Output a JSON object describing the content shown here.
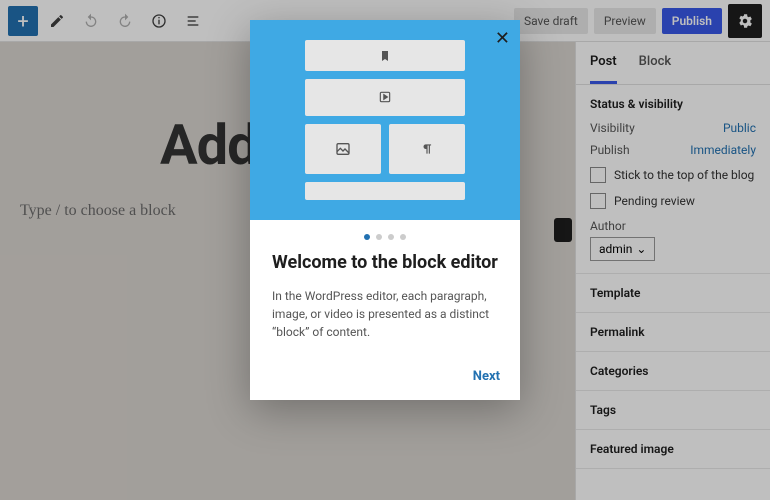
{
  "toolbar": {
    "save_draft": "Save draft",
    "preview": "Preview",
    "publish": "Publish"
  },
  "canvas": {
    "title_placeholder": "Add",
    "block_prompt": "Type / to choose a block"
  },
  "sidebar": {
    "tabs": {
      "post": "Post",
      "block": "Block"
    },
    "status_section": "Status & visibility",
    "visibility_label": "Visibility",
    "visibility_value": "Public",
    "publish_label": "Publish",
    "publish_value": "Immediately",
    "sticky": "Stick to the top of the blog",
    "pending": "Pending review",
    "author_label": "Author",
    "author_value": "admin",
    "sections": {
      "template": "Template",
      "permalink": "Permalink",
      "categories": "Categories",
      "tags": "Tags",
      "featured": "Featured image"
    }
  },
  "modal": {
    "title": "Welcome to the block editor",
    "body": "In the WordPress editor, each paragraph, image, or video is presented as a distinct “block” of content.",
    "next": "Next"
  }
}
